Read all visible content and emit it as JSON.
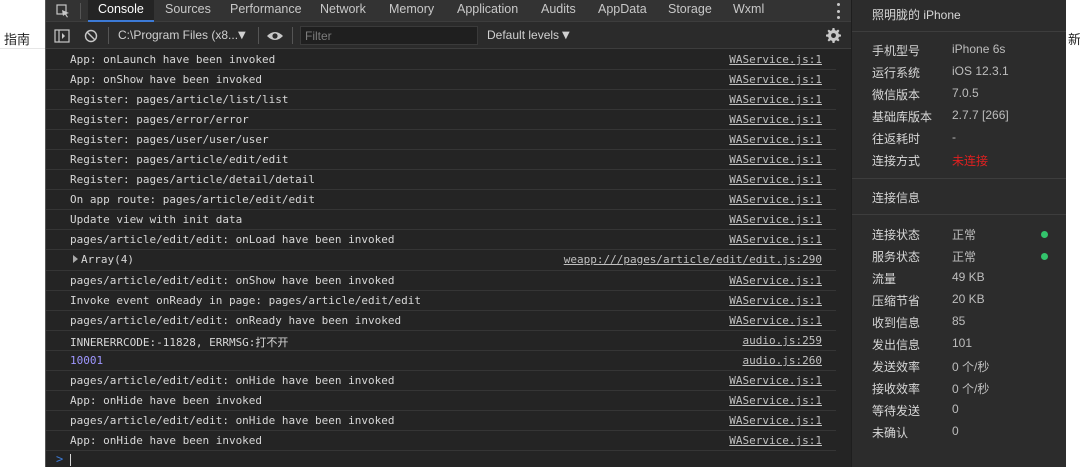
{
  "background": {
    "left_text": "指南",
    "right_text": "新"
  },
  "tabs": [
    "Console",
    "Sources",
    "Performance",
    "Network",
    "Memory",
    "Application",
    "Audits",
    "AppData",
    "Storage",
    "Wxml"
  ],
  "toolbar": {
    "context": "C:\\Program Files (x8...",
    "filter_placeholder": "Filter",
    "levels": "Default levels"
  },
  "console": {
    "rows": [
      {
        "text": "App: onLaunch have been invoked",
        "src": "WAService.js:1"
      },
      {
        "text": "App: onShow have been invoked",
        "src": "WAService.js:1"
      },
      {
        "text": "Register: pages/article/list/list",
        "src": "WAService.js:1"
      },
      {
        "text": "Register: pages/error/error",
        "src": "WAService.js:1"
      },
      {
        "text": "Register: pages/user/user/user",
        "src": "WAService.js:1"
      },
      {
        "text": "Register: pages/article/edit/edit",
        "src": "WAService.js:1"
      },
      {
        "text": "Register: pages/article/detail/detail",
        "src": "WAService.js:1"
      },
      {
        "text": "On app route: pages/article/edit/edit",
        "src": "WAService.js:1"
      },
      {
        "text": "Update view with init data",
        "src": "WAService.js:1"
      },
      {
        "text": "pages/article/edit/edit: onLoad have been invoked",
        "src": "WAService.js:1"
      },
      {
        "text": "Array(4)",
        "src": "weapp:///pages/article/edit/edit.js:290"
      },
      {
        "text": "pages/article/edit/edit: onShow have been invoked",
        "src": "WAService.js:1"
      },
      {
        "text": "Invoke event onReady in page: pages/article/edit/edit",
        "src": "WAService.js:1"
      },
      {
        "text": "pages/article/edit/edit: onReady have been invoked",
        "src": "WAService.js:1"
      },
      {
        "text": "INNERERRCODE:-11828, ERRMSG:打不开",
        "src": "audio.js:259"
      },
      {
        "text": "10001",
        "src": "audio.js:260"
      },
      {
        "text": "pages/article/edit/edit: onHide have been invoked",
        "src": "WAService.js:1"
      },
      {
        "text": "App: onHide have been invoked",
        "src": "WAService.js:1"
      },
      {
        "text": "pages/article/edit/edit: onHide have been invoked",
        "src": "WAService.js:1"
      },
      {
        "text": "App: onHide have been invoked",
        "src": "WAService.js:1"
      }
    ],
    "prompt": ">"
  },
  "info": {
    "device_title": "照明胧的 iPhone",
    "device": [
      {
        "k": "手机型号",
        "v": "iPhone 6s"
      },
      {
        "k": "运行系统",
        "v": "iOS 12.3.1"
      },
      {
        "k": "微信版本",
        "v": "7.0.5"
      },
      {
        "k": "基础库版本",
        "v": "2.7.7 [266]"
      },
      {
        "k": "往返耗时",
        "v": "-"
      },
      {
        "k": "连接方式",
        "v": "未连接"
      }
    ],
    "conn_title": "连接信息",
    "conn": [
      {
        "k": "连接状态",
        "v": "正常"
      },
      {
        "k": "服务状态",
        "v": "正常"
      },
      {
        "k": "流量",
        "v": "49 KB"
      },
      {
        "k": "压缩节省",
        "v": "20 KB"
      },
      {
        "k": "收到信息",
        "v": "85"
      },
      {
        "k": "发出信息",
        "v": "101"
      },
      {
        "k": "发送效率",
        "v": "0 个/秒"
      },
      {
        "k": "接收效率",
        "v": "0 个/秒"
      },
      {
        "k": "等待发送",
        "v": "0"
      },
      {
        "k": "未确认",
        "v": "0"
      }
    ]
  },
  "colors": {
    "accent": "#3c7ad6",
    "status_ok": "#33c46c",
    "status_error": "#e02020"
  }
}
